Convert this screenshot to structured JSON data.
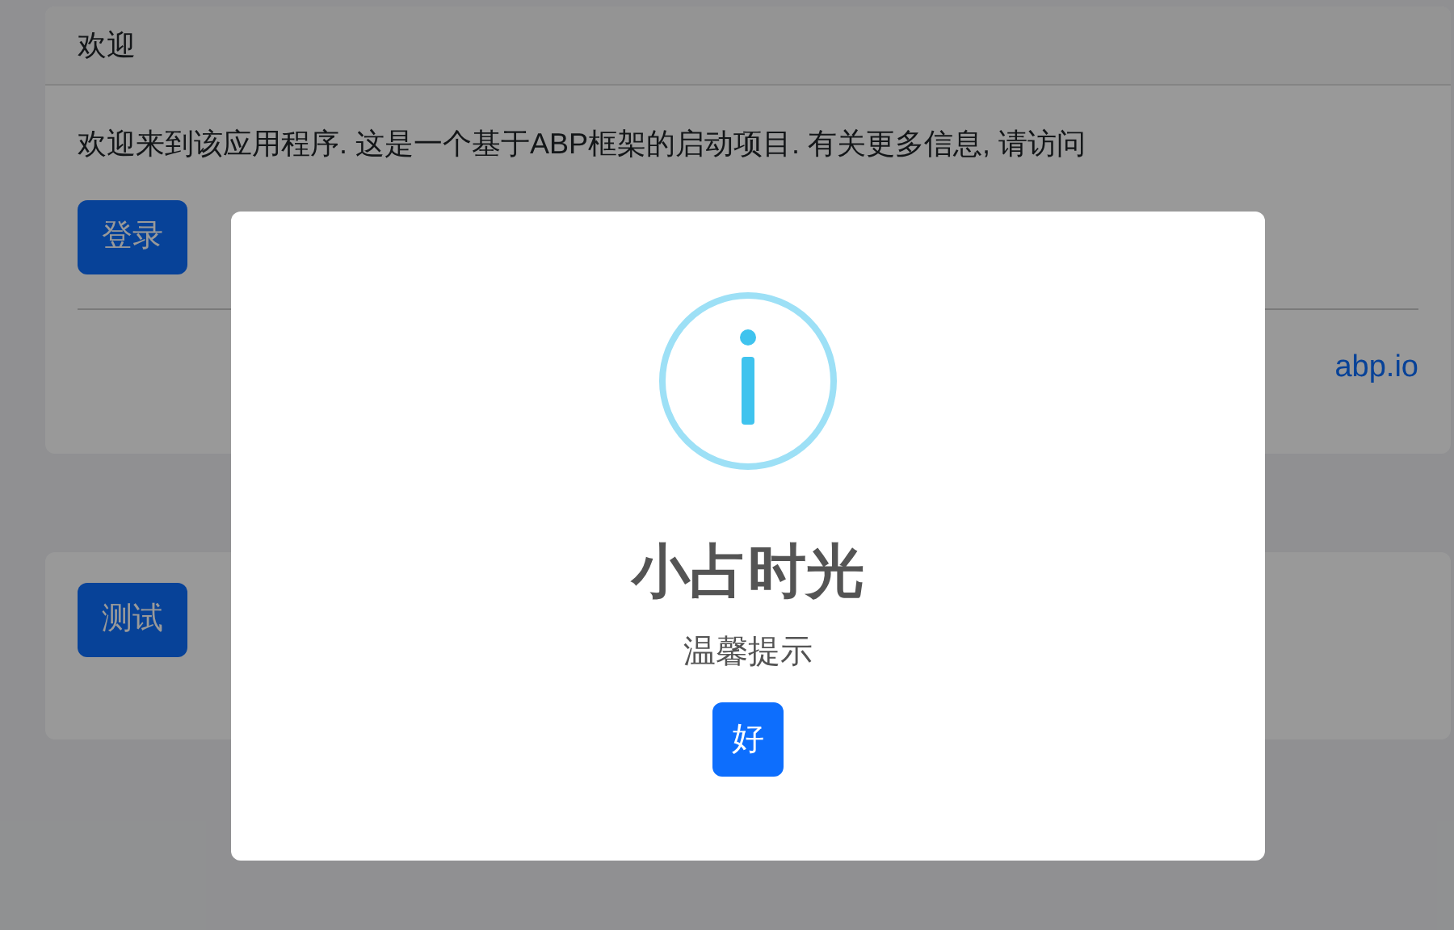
{
  "welcome_card": {
    "header": "欢迎",
    "text": "欢迎来到该应用程序. 这是一个基于ABP框架的启动项目. 有关更多信息, 请访问",
    "login_button": "登录",
    "link": "abp.io"
  },
  "test_card": {
    "button": "测试"
  },
  "dialog": {
    "title": "小占时光",
    "text": "温馨提示",
    "confirm_button": "好"
  }
}
